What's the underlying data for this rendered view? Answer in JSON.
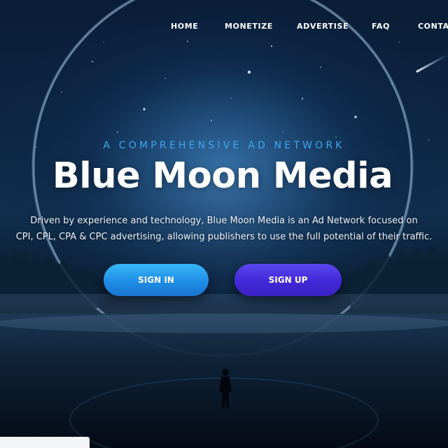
{
  "nav": {
    "items": [
      {
        "label": "HOME"
      },
      {
        "label": "MONETIZE"
      },
      {
        "label": "ADVERTISE"
      },
      {
        "label": "FAQ"
      },
      {
        "label": "CONTA"
      }
    ]
  },
  "hero": {
    "tagline": "A COMPREHENSIVE AD NETWORK",
    "title": "Blue Moon Media",
    "description_line1": "Driven by experience and technology, Blue Moon Media is an Ad Network focused on",
    "description_line2": "CPI, CPL, CPA & CPC advertising, allowing publishers to use the full potential of their traffic.",
    "buttons": {
      "signin_label": "SIGN IN",
      "signup_label": "SIGN UP"
    }
  },
  "colors": {
    "accent_blue": "#3fa7ee",
    "signin_button": "#1f8ee6",
    "signup_button": "#4328d8",
    "background": "#0b1f34"
  }
}
